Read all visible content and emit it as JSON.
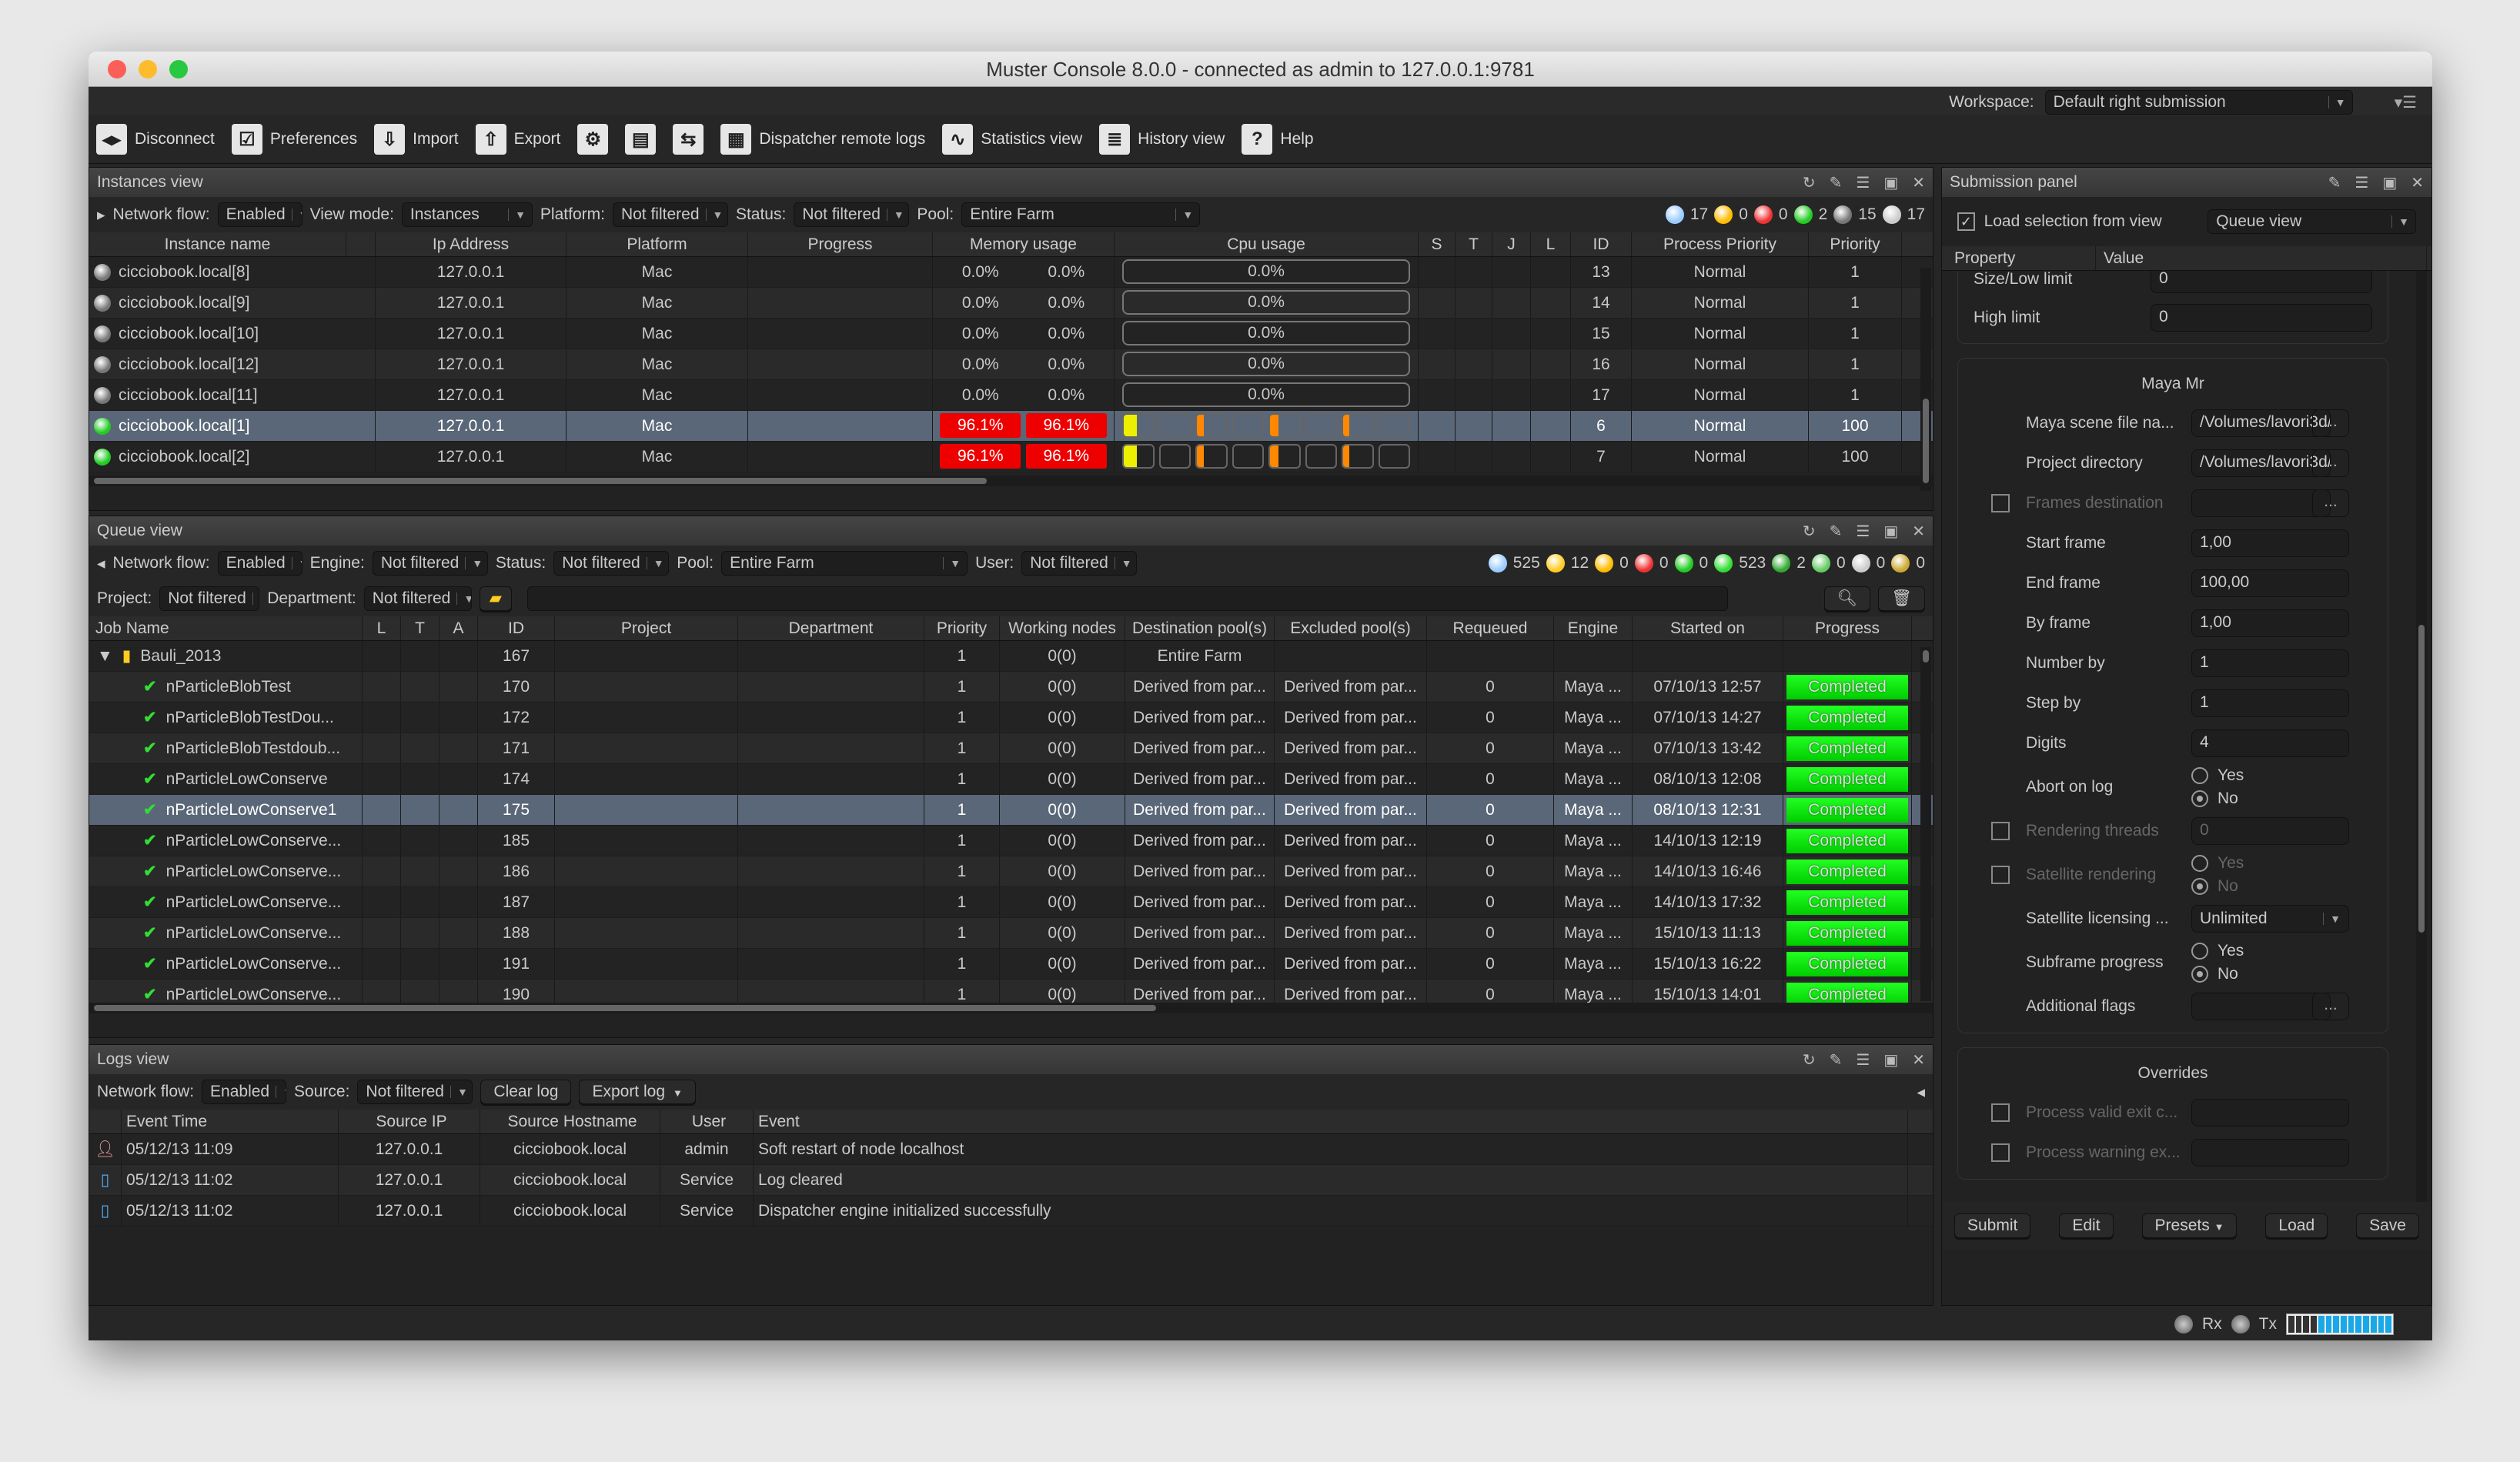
{
  "window": {
    "title": "Muster Console 8.0.0 - connected as admin to 127.0.0.1:9781"
  },
  "workspace": {
    "label": "Workspace:",
    "value": "Default right submission"
  },
  "toolbar": [
    {
      "label": "Disconnect",
      "icon": "disconnect-icon",
      "glyph": "◂▸"
    },
    {
      "label": "Preferences",
      "icon": "preferences-icon",
      "glyph": "☑"
    },
    {
      "label": "Import",
      "icon": "import-icon",
      "glyph": "⇩"
    },
    {
      "label": "Export",
      "icon": "export-icon",
      "glyph": "⇧"
    },
    {
      "label": "",
      "icon": "gears-dropdown-icon",
      "glyph": "⚙"
    },
    {
      "label": "",
      "icon": "render-dropdown-icon",
      "glyph": "▤"
    },
    {
      "label": "",
      "icon": "terminal-dropdown-icon",
      "glyph": "⇆"
    },
    {
      "label": "Dispatcher remote logs",
      "icon": "remote-logs-icon",
      "glyph": "▦"
    },
    {
      "label": "Statistics view",
      "icon": "statistics-icon",
      "glyph": "∿"
    },
    {
      "label": "History view",
      "icon": "history-icon",
      "glyph": "≣"
    },
    {
      "label": "Help",
      "icon": "help-icon",
      "glyph": "?"
    }
  ],
  "instances": {
    "title": "Instances view",
    "filters": {
      "network_flow_label": "Network flow:",
      "network_flow": "Enabled",
      "view_mode_label": "View mode:",
      "view_mode": "Instances",
      "platform_label": "Platform:",
      "platform": "Not filtered",
      "status_label": "Status:",
      "status": "Not filtered",
      "pool_label": "Pool:",
      "pool": "Entire Farm"
    },
    "counts": {
      "total": "17",
      "yellow": "0",
      "red": "0",
      "green": "2",
      "gray": "15",
      "gears": "17"
    },
    "columns": [
      "Instance name",
      "",
      "Ip Address",
      "Platform",
      "Progress",
      "Memory usage",
      "Cpu usage",
      "S",
      "T",
      "J",
      "L",
      "ID",
      "Process Priority",
      "Priority"
    ],
    "rows": [
      {
        "name": "cicciobook.local[8]",
        "ip": "127.0.0.1",
        "platform": "Mac",
        "mem1": "0.0%",
        "mem2": "0.0%",
        "cpu": "0.0%",
        "id": "13",
        "pp": "Normal",
        "priority": "1",
        "state": "offline"
      },
      {
        "name": "cicciobook.local[9]",
        "ip": "127.0.0.1",
        "platform": "Mac",
        "mem1": "0.0%",
        "mem2": "0.0%",
        "cpu": "0.0%",
        "id": "14",
        "pp": "Normal",
        "priority": "1",
        "state": "offline"
      },
      {
        "name": "cicciobook.local[10]",
        "ip": "127.0.0.1",
        "platform": "Mac",
        "mem1": "0.0%",
        "mem2": "0.0%",
        "cpu": "0.0%",
        "id": "15",
        "pp": "Normal",
        "priority": "1",
        "state": "offline"
      },
      {
        "name": "cicciobook.local[12]",
        "ip": "127.0.0.1",
        "platform": "Mac",
        "mem1": "0.0%",
        "mem2": "0.0%",
        "cpu": "0.0%",
        "id": "16",
        "pp": "Normal",
        "priority": "1",
        "state": "offline"
      },
      {
        "name": "cicciobook.local[11]",
        "ip": "127.0.0.1",
        "platform": "Mac",
        "mem1": "0.0%",
        "mem2": "0.0%",
        "cpu": "0.0%",
        "id": "17",
        "pp": "Normal",
        "priority": "1",
        "state": "offline"
      },
      {
        "name": "cicciobook.local[1]",
        "ip": "127.0.0.1",
        "platform": "Mac",
        "mem1": "96.1%",
        "mem2": "96.1%",
        "cores": [
          0.45,
          0,
          0.25,
          0,
          0.3,
          0,
          0.2,
          0
        ],
        "id": "6",
        "pp": "Normal",
        "priority": "100",
        "state": "online",
        "selected": true
      },
      {
        "name": "cicciobook.local[2]",
        "ip": "127.0.0.1",
        "platform": "Mac",
        "mem1": "96.1%",
        "mem2": "96.1%",
        "cores": [
          0.45,
          0,
          0.25,
          0,
          0.3,
          0,
          0.2,
          0
        ],
        "id": "7",
        "pp": "Normal",
        "priority": "100",
        "state": "online"
      }
    ]
  },
  "queue": {
    "title": "Queue view",
    "filters": {
      "network_flow_label": "Network flow:",
      "network_flow": "Enabled",
      "engine_label": "Engine:",
      "engine": "Not filtered",
      "status_label": "Status:",
      "status": "Not filtered",
      "pool_label": "Pool:",
      "pool": "Entire Farm",
      "user_label": "User:",
      "user": "Not filtered",
      "project_label": "Project:",
      "project": "Not filtered",
      "department_label": "Department:",
      "department": "Not filtered",
      "search": ""
    },
    "counts": [
      {
        "icon": "search-icon",
        "v": "525"
      },
      {
        "icon": "folder-icon",
        "v": "12"
      },
      {
        "icon": "yellow-dot-icon",
        "v": "0"
      },
      {
        "icon": "red-dot-icon",
        "v": "0"
      },
      {
        "icon": "green-dot-icon",
        "v": "0"
      },
      {
        "icon": "check-icon",
        "v": "523"
      },
      {
        "icon": "bug-icon",
        "v": "2"
      },
      {
        "icon": "check-circle-icon",
        "v": "0"
      },
      {
        "icon": "lock-icon",
        "v": "0"
      },
      {
        "icon": "box-icon",
        "v": "0"
      }
    ],
    "columns": [
      "Job Name",
      "L",
      "T",
      "A",
      "ID",
      "Project",
      "Department",
      "Priority",
      "Working nodes",
      "Destination pool(s)",
      "Excluded pool(s)",
      "Requeued",
      "Engine",
      "Started on",
      "Progress"
    ],
    "folder": {
      "name": "Bauli_2013",
      "id": "167",
      "priority": "1",
      "nodes": "0(0)",
      "dest": "Entire Farm"
    },
    "rows": [
      {
        "name": "nParticleBlobTest",
        "id": "170",
        "started": "07/10/13 12:57"
      },
      {
        "name": "nParticleBlobTestDou...",
        "id": "172",
        "started": "07/10/13 14:27"
      },
      {
        "name": "nParticleBlobTestdoub...",
        "id": "171",
        "started": "07/10/13 13:42"
      },
      {
        "name": "nParticleLowConserve",
        "id": "174",
        "started": "08/10/13 12:08"
      },
      {
        "name": "nParticleLowConserve1",
        "id": "175",
        "started": "08/10/13 12:31",
        "selected": true
      },
      {
        "name": "nParticleLowConserve...",
        "id": "185",
        "started": "14/10/13 12:19"
      },
      {
        "name": "nParticleLowConserve...",
        "id": "186",
        "started": "14/10/13 16:46"
      },
      {
        "name": "nParticleLowConserve...",
        "id": "187",
        "started": "14/10/13 17:32"
      },
      {
        "name": "nParticleLowConserve...",
        "id": "188",
        "started": "15/10/13 11:13"
      },
      {
        "name": "nParticleLowConserve...",
        "id": "191",
        "started": "15/10/13 16:22"
      },
      {
        "name": "nParticleLowConserve...",
        "id": "190",
        "started": "15/10/13 14:01"
      }
    ],
    "common": {
      "priority": "1",
      "nodes": "0(0)",
      "dest": "Derived from par...",
      "excluded": "Derived from par...",
      "requeued": "0",
      "engine": "Maya ...",
      "progress": "Completed"
    }
  },
  "logs": {
    "title": "Logs view",
    "filters": {
      "network_flow_label": "Network flow:",
      "network_flow": "Enabled",
      "source_label": "Source:",
      "source": "Not filtered",
      "clear": "Clear log",
      "export": "Export log"
    },
    "columns": [
      "",
      "Event Time",
      "Source IP",
      "Source Hostname",
      "User",
      "Event"
    ],
    "rows": [
      {
        "icon": "user-icon",
        "time": "05/12/13 11:09",
        "ip": "127.0.0.1",
        "host": "cicciobook.local",
        "user": "admin",
        "event": "Soft restart of node localhost"
      },
      {
        "icon": "service-icon",
        "time": "05/12/13 11:02",
        "ip": "127.0.0.1",
        "host": "cicciobook.local",
        "user": "Service",
        "event": "Log cleared"
      },
      {
        "icon": "service-icon",
        "time": "05/12/13 11:02",
        "ip": "127.0.0.1",
        "host": "cicciobook.local",
        "user": "Service",
        "event": "Dispatcher engine initialized successfully"
      }
    ]
  },
  "submission": {
    "title": "Submission panel",
    "load_selection": "Load selection from view",
    "load_selection_checked": true,
    "view": "Queue view",
    "prop_header": "Property",
    "value_header": "Value",
    "limits": [
      {
        "label": "Size/Low limit",
        "value": "0"
      },
      {
        "label": "High limit",
        "value": "0"
      }
    ],
    "maya_title": "Maya Mr",
    "fields": [
      {
        "label": "Maya scene file na...",
        "value": "/Volumes/lavori3d/",
        "type": "browse"
      },
      {
        "label": "Project directory",
        "value": "/Volumes/lavori3d/",
        "type": "browse"
      },
      {
        "label": "Frames destination",
        "value": "",
        "type": "browse",
        "check": true,
        "disabled": true
      },
      {
        "label": "Start frame",
        "value": "1,00",
        "type": "text"
      },
      {
        "label": "End frame",
        "value": "100,00",
        "type": "text"
      },
      {
        "label": "By frame",
        "value": "1,00",
        "type": "text"
      },
      {
        "label": "Number by",
        "value": "1",
        "type": "text"
      },
      {
        "label": "Step by",
        "value": "1",
        "type": "text"
      },
      {
        "label": "Digits",
        "value": "4",
        "type": "text"
      },
      {
        "label": "Abort on log",
        "type": "radio",
        "yes": "Yes",
        "no": "No",
        "value": "No"
      },
      {
        "label": "Rendering threads",
        "value": "0",
        "type": "text",
        "check": true,
        "disabled": true
      },
      {
        "label": "Satellite rendering",
        "type": "radio",
        "yes": "Yes",
        "no": "No",
        "value": "No",
        "check": true,
        "disabled": true
      },
      {
        "label": "Satellite licensing ...",
        "value": "Unlimited",
        "type": "select"
      },
      {
        "label": "Subframe progress",
        "type": "radio",
        "yes": "Yes",
        "no": "No",
        "value": "No"
      },
      {
        "label": "Additional flags",
        "value": "",
        "type": "browse"
      }
    ],
    "overrides_title": "Overrides",
    "overrides": [
      {
        "label": "Process valid exit c...",
        "value": "",
        "type": "text",
        "check": true,
        "disabled": true
      },
      {
        "label": "Process warning ex...",
        "value": "",
        "type": "text",
        "check": true,
        "disabled": true
      }
    ],
    "buttons": {
      "submit": "Submit",
      "edit": "Edit",
      "presets": "Presets",
      "load": "Load",
      "save": "Save"
    }
  },
  "status": {
    "rx": "Rx",
    "tx": "Tx",
    "traffic_level": 0.75
  },
  "colors": {
    "completed": "#22dd22",
    "memory_high": "#e00000",
    "selected_row": "#5a6778",
    "online": "#22cc22",
    "offline": "#777777"
  }
}
